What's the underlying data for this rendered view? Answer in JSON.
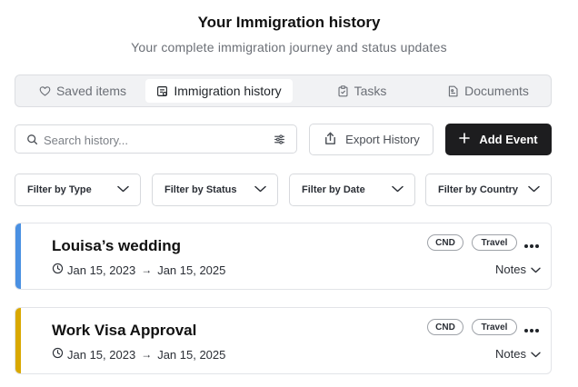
{
  "header": {
    "title": "Your Immigration history",
    "subtitle": "Your complete immigration journey and status updates"
  },
  "tabs": [
    {
      "label": "Saved items",
      "icon": "heart-icon",
      "active": false
    },
    {
      "label": "Immigration history",
      "icon": "history-icon",
      "active": true
    },
    {
      "label": "Tasks",
      "icon": "clipboard-icon",
      "active": false
    },
    {
      "label": "Documents",
      "icon": "document-icon",
      "active": false
    }
  ],
  "toolbar": {
    "search_placeholder": "Search history...",
    "search_value": "",
    "export_label": "Export History",
    "add_label": "Add Event"
  },
  "filters": [
    {
      "label": "Filter by Type"
    },
    {
      "label": "Filter by Status"
    },
    {
      "label": "Filter by Date"
    },
    {
      "label": "Filter by Country"
    }
  ],
  "events": [
    {
      "title": "Louisa’s wedding",
      "start": "Jan 15, 2023",
      "end": "Jan 15, 2025",
      "country": "CND",
      "category": "Travel",
      "notes_label": "Notes",
      "accent": "#4a90e2"
    },
    {
      "title": "Work Visa Approval",
      "start": "Jan 15, 2023",
      "end": "Jan 15, 2025",
      "country": "CND",
      "category": "Travel",
      "notes_label": "Notes",
      "accent": "#d9a800"
    }
  ],
  "colors": {
    "primary_button": "#1d1d1f",
    "tab_bar_bg": "#f1f2f4"
  }
}
